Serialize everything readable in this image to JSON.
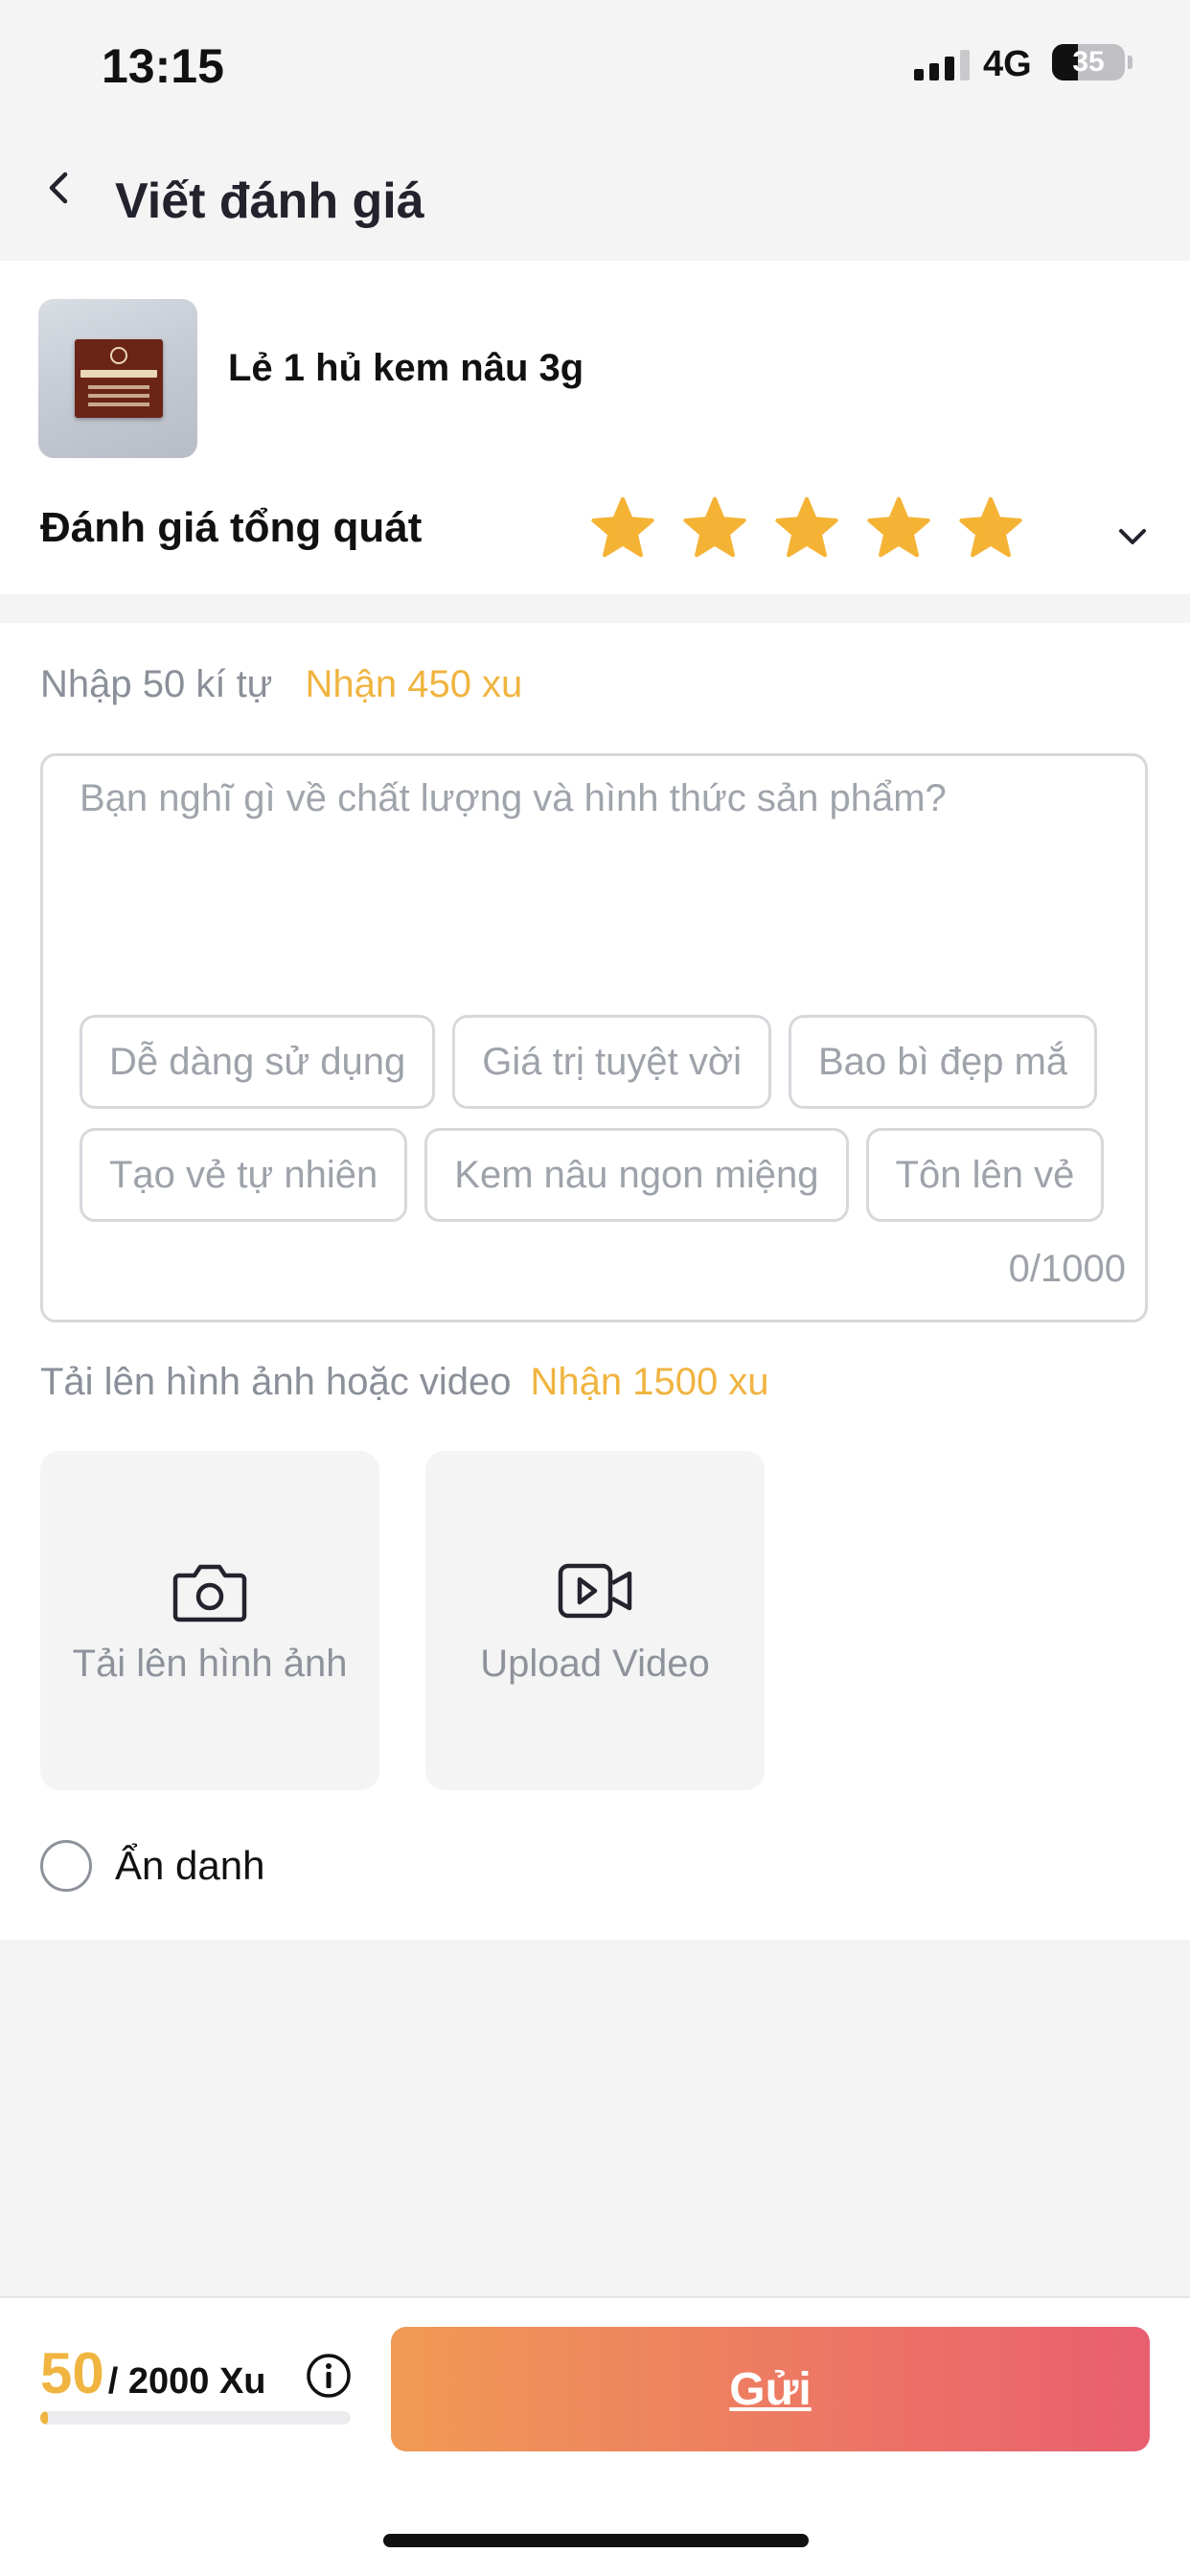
{
  "status_bar": {
    "time": "13:15",
    "network": "4G",
    "battery": "35",
    "battery_level": 0.35,
    "icons": [
      "cellular-signal-icon",
      "battery-icon"
    ]
  },
  "nav": {
    "title": "Viết đánh giá",
    "back_icon": "chevron-left-icon"
  },
  "product": {
    "name": "Lẻ 1 hủ kem nâu 3g",
    "thumbnail_icon": "product-thumbnail"
  },
  "rating": {
    "label": "Đánh giá tổng quát",
    "value": 5,
    "max": 5,
    "star_color": "#f5b335",
    "expand_icon": "chevron-down-icon"
  },
  "review": {
    "hint": "Nhập 50 kí tự",
    "reward": "Nhận 450 xu",
    "placeholder": "Bạn nghĩ gì về chất lượng và hình thức sản phẩm?",
    "tags_row1": [
      "Dễ dàng sử dụng",
      "Giá trị tuyệt vời",
      "Bao bì đẹp mắ"
    ],
    "tags_row2": [
      "Tạo vẻ tự nhiên",
      "Kem nâu ngon miệng",
      "Tôn lên vẻ"
    ],
    "char_count": "0/1000"
  },
  "media": {
    "hint": "Tải lên hình ảnh hoặc video",
    "reward": "Nhận 1500 xu",
    "photo_label": "Tải lên hình ảnh",
    "photo_icon": "camera-icon",
    "video_label": "Upload Video",
    "video_icon": "video-camera-icon"
  },
  "anonymous": {
    "label": "Ẩn danh",
    "checked": false
  },
  "bottom": {
    "coins_current": "50",
    "coins_total": "/ 2000 Xu",
    "progress_fraction": 0.025,
    "info_icon": "info-icon",
    "submit_label": "Gửi"
  },
  "colors": {
    "accent_coin": "#f0b440",
    "button_gradient_start": "#f09a55",
    "button_gradient_end": "#e85f70",
    "star": "#f5b335"
  }
}
